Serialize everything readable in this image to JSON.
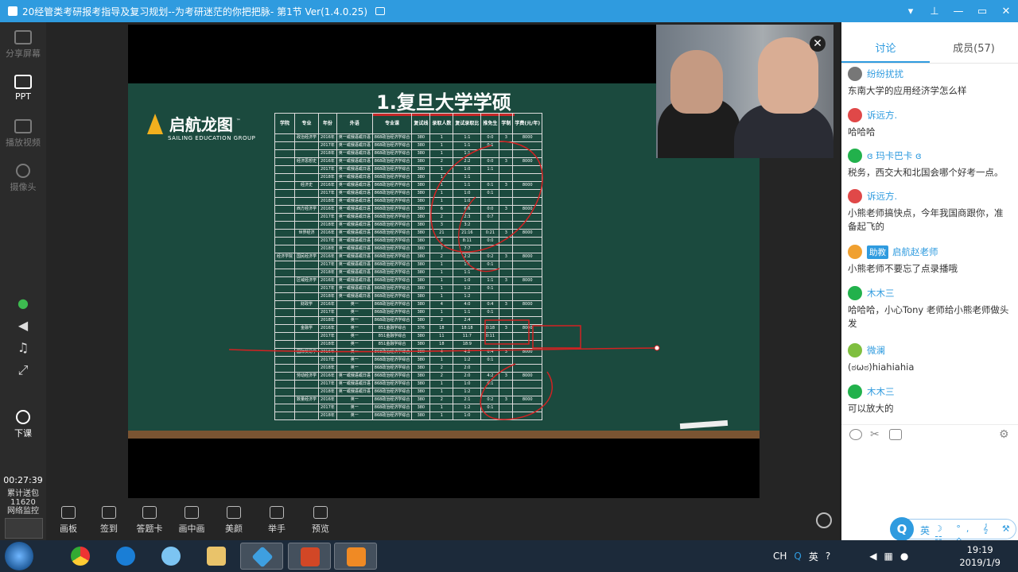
{
  "window": {
    "title": "20经管类考研报考指导及复习规划--为考研迷茫的你把把脉- 第1节 Ver(1.4.0.25)",
    "controls": [
      "▾",
      "⊥",
      "—",
      "▭",
      "✕"
    ]
  },
  "leftrail": {
    "items": [
      {
        "label": "分享屏幕",
        "icon": "share-screen-icon",
        "active": false
      },
      {
        "label": "PPT",
        "icon": "ppt-icon",
        "active": true
      },
      {
        "label": "播放视频",
        "icon": "play-video-icon",
        "active": false
      },
      {
        "label": "摄像头",
        "icon": "camera-icon",
        "active": false
      },
      {
        "label": "下课",
        "icon": "end-class-icon",
        "active": true
      }
    ],
    "timer": "00:27:39",
    "stats_label": "累计送包",
    "stats_value": "11620",
    "network_label": "网络监控"
  },
  "slide": {
    "title": "1.复旦大学学硕",
    "logo_name": "启航龙图",
    "logo_tm": "™",
    "logo_sub": "SAILING EDUCATION GROUP",
    "table": {
      "headers": [
        "学院",
        "专业",
        "年份",
        "外语",
        "专业课",
        "复试线",
        "录取人数",
        "复试录取比",
        "推免生",
        "学制",
        "学费(元/年)"
      ],
      "rows": [
        [
          "",
          "政治经济学",
          "2016年",
          "英一或俄语或日语",
          "868政治经济学综合",
          "380",
          "1",
          "1:1",
          "0:0",
          "3",
          "8000"
        ],
        [
          "",
          "",
          "2017年",
          "英一或俄语或日语",
          "868政治经济学综合",
          "380",
          "1",
          "1:1",
          "0:1",
          "",
          ""
        ],
        [
          "",
          "",
          "2018年",
          "英一或俄语或日语",
          "868政治经济学综合",
          "380",
          "1",
          "1:1",
          "",
          "",
          ""
        ],
        [
          "",
          "经济思想史",
          "2016年",
          "英一或俄语或日语",
          "868政治经济学综合",
          "380",
          "2",
          "2:2",
          "0:0",
          "3",
          "8000"
        ],
        [
          "",
          "",
          "2017年",
          "英一或俄语或日语",
          "868政治经济学综合",
          "380",
          "1",
          "1:0",
          "1:1",
          "",
          ""
        ],
        [
          "",
          "",
          "2018年",
          "英一或俄语或日语",
          "868政治经济学综合",
          "380",
          "1",
          "1:1",
          "",
          "",
          ""
        ],
        [
          "",
          "经济史",
          "2016年",
          "英一或俄语或日语",
          "868政治经济学综合",
          "380",
          "1",
          "1:1",
          "0:1",
          "3",
          "8000"
        ],
        [
          "",
          "",
          "2017年",
          "英一或俄语或日语",
          "868政治经济学综合",
          "380",
          "1",
          "1:0",
          "0:1",
          "",
          ""
        ],
        [
          "",
          "",
          "2018年",
          "英一或俄语或日语",
          "868政治经济学综合",
          "380",
          "1",
          "1:0",
          "",
          "",
          ""
        ],
        [
          "",
          "西方经济学",
          "2016年",
          "英一或俄语或日语",
          "868政治经济学综合",
          "380",
          "6",
          "6:6",
          "0:0",
          "3",
          "8000"
        ],
        [
          "",
          "",
          "2017年",
          "英一或俄语或日语",
          "868政治经济学综合",
          "380",
          "2",
          "2:3",
          "0:7",
          "",
          ""
        ],
        [
          "",
          "",
          "2018年",
          "英一或俄语或日语",
          "868政治经济学综合",
          "380",
          "3",
          "3:2",
          "",
          "",
          ""
        ],
        [
          "",
          "世界经济",
          "2016年",
          "英一或俄语或日语",
          "868政治经济学综合",
          "380",
          "21",
          "21:16",
          "0:21",
          "3",
          "8000"
        ],
        [
          "",
          "",
          "2017年",
          "英一或俄语或日语",
          "868政治经济学综合",
          "380",
          "8",
          "8:11",
          "0:0",
          "",
          ""
        ],
        [
          "",
          "",
          "2018年",
          "英一或俄语或日语",
          "868政治经济学综合",
          "380",
          "7",
          "7:7",
          "",
          "",
          ""
        ],
        [
          "经济学院",
          "国民经济学",
          "2016年",
          "英一或俄语或日语",
          "868政治经济学综合",
          "380",
          "2",
          "2:2",
          "0:2",
          "3",
          "8000"
        ],
        [
          "",
          "",
          "2017年",
          "英一或俄语或日语",
          "868政治经济学综合",
          "380",
          "1",
          "1:1",
          "0:1",
          "",
          ""
        ],
        [
          "",
          "",
          "2018年",
          "英一或俄语或日语",
          "868政治经济学综合",
          "380",
          "1",
          "1:1",
          "",
          "",
          ""
        ],
        [
          "",
          "区域经济学",
          "2016年",
          "英一或俄语或日语",
          "868政治经济学综合",
          "380",
          "1",
          "1:0",
          "1:1",
          "3",
          "8000"
        ],
        [
          "",
          "",
          "2017年",
          "英一或俄语或日语",
          "868政治经济学综合",
          "380",
          "1",
          "1:2",
          "0:1",
          "",
          ""
        ],
        [
          "",
          "",
          "2018年",
          "英一或俄语或日语",
          "868政治经济学综合",
          "380",
          "1",
          "1:2",
          "",
          "",
          ""
        ],
        [
          "",
          "财政学",
          "2016年",
          "英一",
          "868政治经济学综合",
          "380",
          "4",
          "4:0",
          "0:4",
          "3",
          "8000"
        ],
        [
          "",
          "",
          "2017年",
          "英一",
          "868政治经济学综合",
          "380",
          "1",
          "1:1",
          "0:1",
          "",
          ""
        ],
        [
          "",
          "",
          "2018年",
          "英一",
          "868政治经济学综合",
          "380",
          "2",
          "2:4",
          "",
          "",
          ""
        ],
        [
          "",
          "金融学",
          "2016年",
          "英一",
          "851金融学综合",
          "376",
          "18",
          "18:18",
          "0:18",
          "3",
          "8000"
        ],
        [
          "",
          "",
          "2017年",
          "英一",
          "851金融学综合",
          "380",
          "11",
          "11:7",
          "0:11",
          "",
          ""
        ],
        [
          "",
          "",
          "2018年",
          "英一",
          "851金融学综合",
          "380",
          "18",
          "18:9",
          "",
          "",
          ""
        ],
        [
          "",
          "国际贸易学",
          "2016年",
          "英一",
          "868政治经济学综合",
          "380",
          "4",
          "4:2",
          "0:4",
          "3",
          "8000"
        ],
        [
          "",
          "",
          "2017年",
          "英一",
          "868政治经济学综合",
          "380",
          "1",
          "1:2",
          "0:1",
          "",
          ""
        ],
        [
          "",
          "",
          "2018年",
          "英一",
          "868政治经济学综合",
          "380",
          "2",
          "2:0",
          "",
          "",
          ""
        ],
        [
          "",
          "劳动经济学",
          "2016年",
          "英一或俄语或日语",
          "868政治经济学综合",
          "380",
          "2",
          "2:0",
          "4:2",
          "3",
          "8000"
        ],
        [
          "",
          "",
          "2017年",
          "英一或俄语或日语",
          "868政治经济学综合",
          "380",
          "1",
          "1:0",
          "0:1",
          "",
          ""
        ],
        [
          "",
          "",
          "2018年",
          "英一或俄语或日语",
          "868政治经济学综合",
          "380",
          "1",
          "1:2",
          "",
          "",
          ""
        ],
        [
          "",
          "数量经济学",
          "2016年",
          "英一",
          "868政治经济学综合",
          "380",
          "2",
          "2:1",
          "0:2",
          "3",
          "8000"
        ],
        [
          "",
          "",
          "2017年",
          "英一",
          "868政治经济学综合",
          "380",
          "1",
          "1:2",
          "0:1",
          "",
          ""
        ],
        [
          "",
          "",
          "2018年",
          "英一",
          "868政治经济学综合",
          "380",
          "1",
          "1:0",
          "",
          "",
          ""
        ]
      ]
    }
  },
  "webcam": {
    "close_label": "✕"
  },
  "toolbar": {
    "items": [
      "画板",
      "签到",
      "答题卡",
      "画中画",
      "美颜",
      "举手",
      "预览"
    ]
  },
  "right_panel": {
    "tabs": [
      {
        "label": "讨论",
        "active": true
      },
      {
        "label": "成员(57)",
        "active": false
      }
    ],
    "messages": [
      {
        "user": "纷纷扰扰",
        "badge": "",
        "avatar_color": "#777777",
        "text": "东南大学的应用经济学怎么样"
      },
      {
        "user": "诉远方.",
        "badge": "",
        "avatar_color": "#e04848",
        "text": "哈哈哈"
      },
      {
        "user": "ɞ 玛卡巴卡 ɞ",
        "badge": "",
        "avatar_color": "#22b14c",
        "text": "税务，西交大和北国会哪个好考一点。"
      },
      {
        "user": "诉远方.",
        "badge": "",
        "avatar_color": "#e04848",
        "text": "小熊老师搞快点，今年我国商跟你，准备起飞的"
      },
      {
        "user": "启航赵老师",
        "badge": "助教",
        "avatar_color": "#f0a030",
        "text": "小熊老师不要忘了点录播哦"
      },
      {
        "user": "木木三",
        "badge": "",
        "avatar_color": "#22b14c",
        "text": "哈哈哈，小心Tony 老师给小熊老师做头发"
      },
      {
        "user": "微澜",
        "badge": "",
        "avatar_color": "#7fbf3f",
        "text": "(ಠωಠ)hiahiahia"
      },
      {
        "user": "木木三",
        "badge": "",
        "avatar_color": "#22b14c",
        "text": "可以放大的"
      }
    ],
    "ime_lang": "英",
    "ime_icons": "☽ °, 𝄞 ⚒ ☷ ⌂"
  },
  "taskbar": {
    "tray_lang": "CH",
    "tray_ime": "英",
    "time": "19:19",
    "date": "2019/1/9"
  }
}
